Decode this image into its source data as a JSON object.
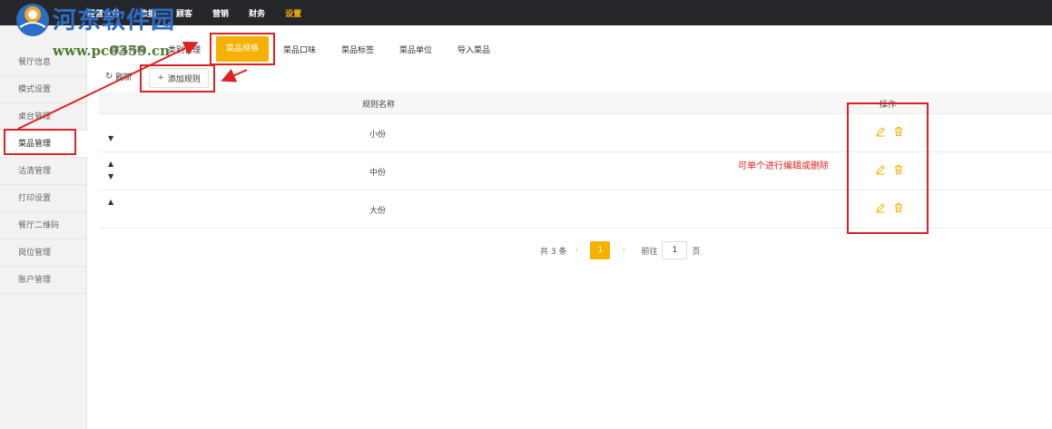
{
  "topnav": {
    "items": [
      {
        "label": "经营业务"
      },
      {
        "label": "数据"
      },
      {
        "label": "顾客"
      },
      {
        "label": "营销"
      },
      {
        "label": "财务"
      },
      {
        "label": "设置",
        "active": true
      }
    ]
  },
  "watermark": {
    "title": "河东软件园",
    "url": "www.pc0359.cn"
  },
  "sidebar": {
    "items": [
      {
        "label": "餐厅信息"
      },
      {
        "label": "模式设置"
      },
      {
        "label": "桌台管理"
      },
      {
        "label": "菜品管理",
        "active": true
      },
      {
        "label": "沽清管理"
      },
      {
        "label": "打印设置"
      },
      {
        "label": "餐厅二维码"
      },
      {
        "label": "岗位管理"
      },
      {
        "label": "账户管理"
      }
    ]
  },
  "subtabs": {
    "items": [
      {
        "label": "菜品列表"
      },
      {
        "label": "类别管理"
      },
      {
        "label": "菜品规格",
        "active": true
      },
      {
        "label": "菜品口味"
      },
      {
        "label": "菜品标签"
      },
      {
        "label": "菜品单位"
      },
      {
        "label": "导入菜品"
      }
    ]
  },
  "toolbar": {
    "refresh_label": "刷新",
    "add_label": "添加规则"
  },
  "table": {
    "columns": [
      "规则名称",
      "操作"
    ],
    "rows": [
      {
        "name": "小份",
        "up": false,
        "down": true
      },
      {
        "name": "中份",
        "up": true,
        "down": true
      },
      {
        "name": "大份",
        "up": true,
        "down": false
      }
    ]
  },
  "pagination": {
    "total_text": "共 3 条",
    "current_page": "1",
    "goto_label": "前往",
    "goto_value": "1",
    "page_suffix": "页"
  },
  "annotation": {
    "note": "可单个进行编辑或删除"
  },
  "colors": {
    "accent": "#f5b100",
    "topbar": "#25272b",
    "annotation": "#e02020"
  }
}
